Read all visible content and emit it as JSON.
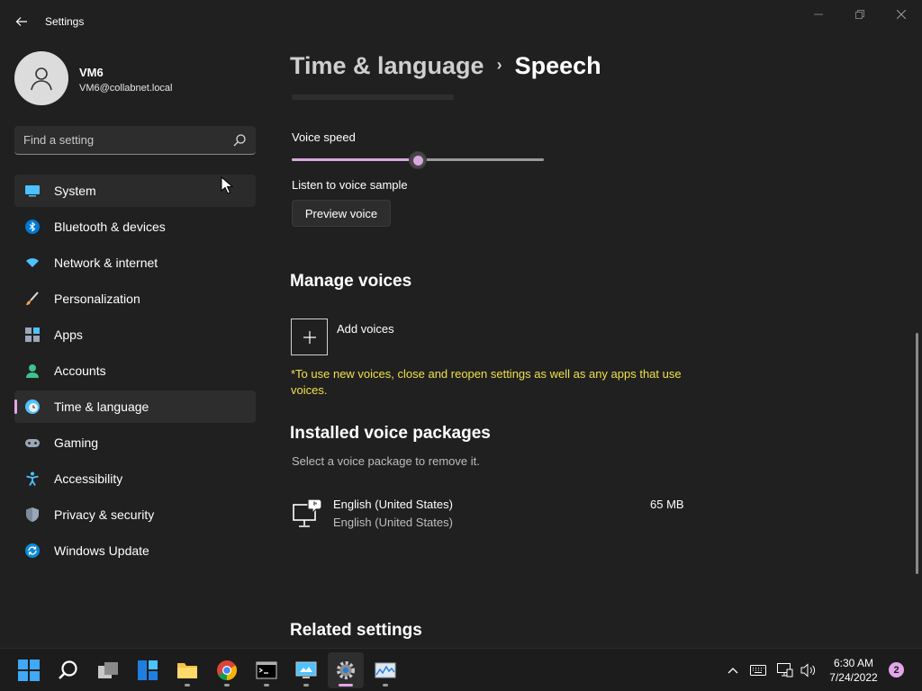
{
  "window": {
    "title": "Settings",
    "controls": {
      "minimize_icon": "minimize-icon",
      "maximize_icon": "restore-icon",
      "close_icon": "close-icon"
    }
  },
  "user": {
    "name": "VM6",
    "email": "VM6@collabnet.local"
  },
  "search": {
    "placeholder": "Find a setting",
    "value": ""
  },
  "sidebar": {
    "items": [
      {
        "label": "System",
        "icon": "system-icon",
        "state": "hover"
      },
      {
        "label": "Bluetooth & devices",
        "icon": "bluetooth-icon"
      },
      {
        "label": "Network & internet",
        "icon": "wifi-icon"
      },
      {
        "label": "Personalization",
        "icon": "brush-icon"
      },
      {
        "label": "Apps",
        "icon": "apps-icon"
      },
      {
        "label": "Accounts",
        "icon": "person-icon"
      },
      {
        "label": "Time & language",
        "icon": "clock-globe-icon",
        "state": "selected"
      },
      {
        "label": "Gaming",
        "icon": "gamepad-icon"
      },
      {
        "label": "Accessibility",
        "icon": "accessibility-icon"
      },
      {
        "label": "Privacy & security",
        "icon": "shield-icon"
      },
      {
        "label": "Windows Update",
        "icon": "update-icon"
      }
    ]
  },
  "breadcrumb": {
    "parent": "Time & language",
    "separator": "›",
    "current": "Speech"
  },
  "voice_speed": {
    "label": "Voice speed",
    "level": 0.5
  },
  "voice_sample": {
    "label": "Listen to voice sample",
    "button": "Preview voice"
  },
  "manage_voices": {
    "title": "Manage voices",
    "add_label": "Add voices",
    "note": "*To use new voices, close and reopen settings as well as any apps that use voices."
  },
  "installed": {
    "title": "Installed voice packages",
    "subtitle": "Select a voice package to remove it.",
    "packages": [
      {
        "name": "English (United States)",
        "sub": "English (United States)",
        "size": "65 MB",
        "icon": "speech-display-icon"
      }
    ]
  },
  "related": {
    "title": "Related settings"
  },
  "taskbar": {
    "apps": [
      "windows-start-icon",
      "search-icon",
      "task-view-icon",
      "widgets-icon",
      "file-explorer-icon",
      "chrome-icon",
      "terminal-icon",
      "remote-desktop-icon",
      "settings-icon",
      "resource-monitor-icon"
    ],
    "clock_time": "6:30 AM",
    "clock_date": "7/24/2022",
    "notification_count": "2"
  },
  "colors": {
    "accent": "#e3a5ea",
    "background": "#202020",
    "note": "#f0e04a"
  }
}
